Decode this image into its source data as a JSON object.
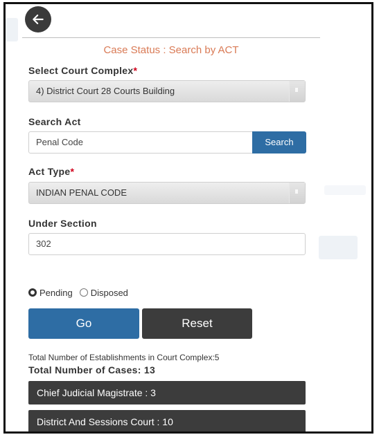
{
  "page_title": "Case Status : Search by ACT",
  "court_complex": {
    "label": "Select Court Complex",
    "required_mark": "*",
    "selected": "4) District Court 28 Courts Building"
  },
  "search_act": {
    "label": "Search Act",
    "value": "Penal Code",
    "button_label": "Search"
  },
  "act_type": {
    "label": "Act Type",
    "required_mark": "*",
    "selected": "INDIAN PENAL CODE"
  },
  "under_section": {
    "label": "Under Section",
    "value": "302"
  },
  "status_filter": {
    "options": [
      "Pending",
      "Disposed"
    ],
    "selected": "Pending"
  },
  "buttons": {
    "go": "Go",
    "reset": "Reset"
  },
  "results": {
    "total_establishments": "Total Number of Establishments in Court Complex:5",
    "total_cases": "Total Number of Cases: 13",
    "courts": [
      {
        "label": "Chief Judicial Magistrate : 3"
      },
      {
        "label": "District And Sessions Court : 10"
      }
    ]
  },
  "icons": {
    "back": "arrow-left-icon"
  },
  "colors": {
    "accent_blue": "#2e6da4",
    "dark_button": "#3c3c3c",
    "title_orange": "#d97a55",
    "required_red": "#d0021b"
  }
}
